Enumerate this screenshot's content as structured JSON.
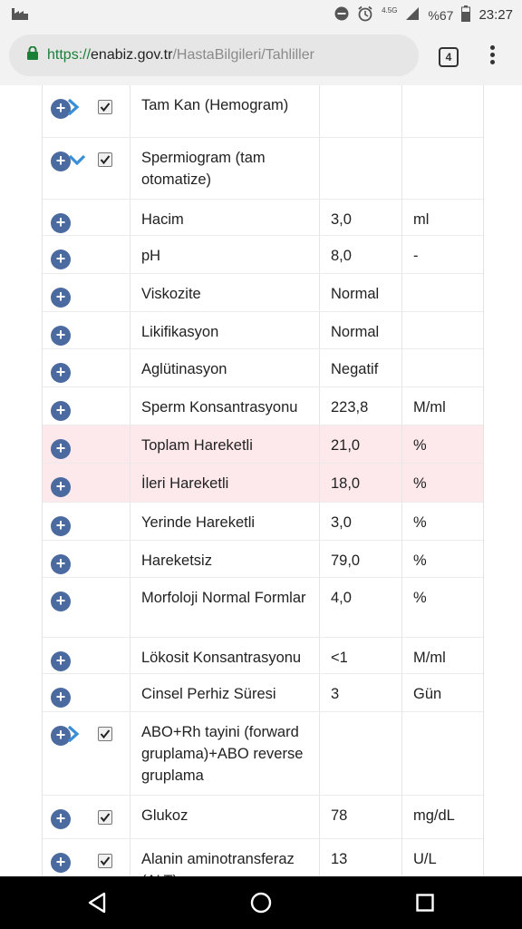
{
  "status": {
    "battery": "%67",
    "time": "23:27",
    "network": "4.5G"
  },
  "browser": {
    "url_scheme": "https://",
    "url_host": "enabiz.gov.tr",
    "url_path": "/HastaBilgileri/Tahliller",
    "tab_count": "4"
  },
  "rows": [
    {
      "name": "Tam Kan (Hemogram)",
      "value": "",
      "unit": ""
    },
    {
      "name": "Spermiogram (tam otomatize)",
      "value": "",
      "unit": ""
    },
    {
      "name": "Hacim",
      "value": "3,0",
      "unit": "ml"
    },
    {
      "name": "pH",
      "value": "8,0",
      "unit": "-"
    },
    {
      "name": "Viskozite",
      "value": "Normal",
      "unit": ""
    },
    {
      "name": "Likifikasyon",
      "value": "Normal",
      "unit": ""
    },
    {
      "name": "Aglütinasyon",
      "value": "Negatif",
      "unit": ""
    },
    {
      "name": "Sperm Konsantrasyonu",
      "value": "223,8",
      "unit": "M/ml"
    },
    {
      "name": "Toplam Hareketli",
      "value": "21,0",
      "unit": "%"
    },
    {
      "name": "İleri Hareketli",
      "value": "18,0",
      "unit": "%"
    },
    {
      "name": "Yerinde Hareketli",
      "value": "3,0",
      "unit": "%"
    },
    {
      "name": "Hareketsiz",
      "value": "79,0",
      "unit": "%"
    },
    {
      "name": "Morfoloji Normal Formlar",
      "value": "4,0",
      "unit": "%"
    },
    {
      "name": "Lökosit Konsantrasyonu",
      "value": "<1",
      "unit": "M/ml"
    },
    {
      "name": "Cinsel Perhiz Süresi",
      "value": "3",
      "unit": "Gün"
    },
    {
      "name": "ABO+Rh tayini (forward gruplama)+ABO reverse gruplama",
      "value": "",
      "unit": ""
    },
    {
      "name": "Glukoz",
      "value": "78",
      "unit": "mg/dL"
    },
    {
      "name": "Alanin aminotransferaz (ALT)",
      "value": "13",
      "unit": "U/L"
    }
  ],
  "colors": {
    "plus": "#4a6aa0",
    "chevron": "#3a8fd6",
    "highlight_row": "#fde9ec"
  },
  "icons": {
    "chevron_right": "chevron-right-icon",
    "chevron_down": "chevron-down-icon"
  }
}
